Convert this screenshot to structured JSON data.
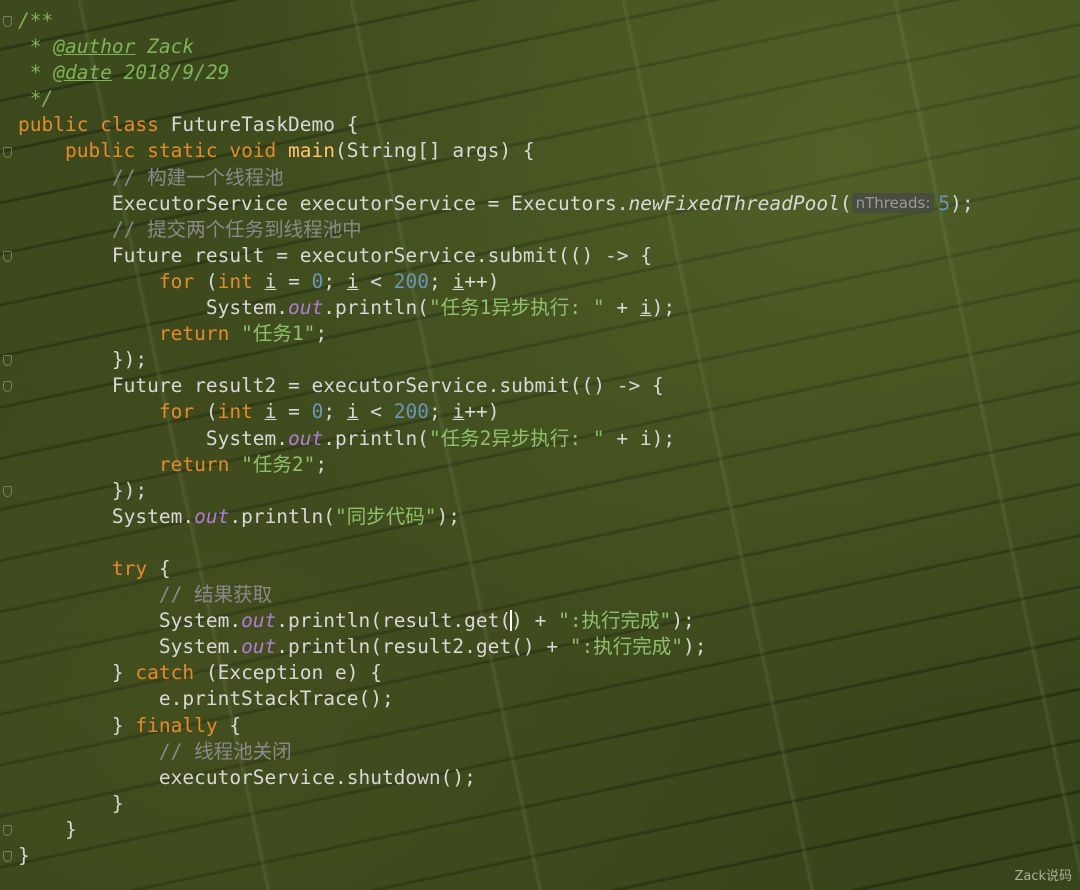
{
  "editor": {
    "language": "Java",
    "theme_colors": {
      "keyword": "#e38b2e",
      "method_decl": "#ffc66d",
      "number": "#6897bb",
      "string": "#8fc06c",
      "comment": "#8a8a8a",
      "static_field": "#b07bd8",
      "javadoc": "#7fb35a"
    },
    "lines": [
      [
        {
          "t": "/**",
          "c": "doc"
        }
      ],
      [
        {
          "t": " * ",
          "c": "doc"
        },
        {
          "t": "@author",
          "c": "doc-tag"
        },
        {
          "t": " Zack",
          "c": "doc"
        }
      ],
      [
        {
          "t": " * ",
          "c": "doc"
        },
        {
          "t": "@date",
          "c": "doc-tag"
        },
        {
          "t": " 2018/9/29",
          "c": "doc"
        }
      ],
      [
        {
          "t": " */",
          "c": "doc"
        }
      ],
      [
        {
          "t": "public class",
          "c": "kw"
        },
        {
          "t": " FutureTaskDemo {"
        }
      ],
      [
        {
          "t": "    "
        },
        {
          "t": "public static void",
          "c": "kw"
        },
        {
          "t": " "
        },
        {
          "t": "main",
          "c": "fn"
        },
        {
          "t": "(String[] args) {"
        }
      ],
      [
        {
          "t": "        "
        },
        {
          "t": "// 构建一个线程池",
          "c": "cmt"
        }
      ],
      [
        {
          "t": "        ExecutorService executorService = Executors."
        },
        {
          "t": "newFixedThreadPool",
          "c": "it"
        },
        {
          "t": "("
        },
        {
          "t": "nThreads:",
          "c": "hint"
        },
        {
          "t": "5",
          "c": "num"
        },
        {
          "t": ");"
        }
      ],
      [
        {
          "t": "        "
        },
        {
          "t": "// 提交两个任务到线程池中",
          "c": "cmt"
        }
      ],
      [
        {
          "t": "        Future result = executorService.submit(() -> {"
        }
      ],
      [
        {
          "t": "            "
        },
        {
          "t": "for",
          "c": "kw"
        },
        {
          "t": " ("
        },
        {
          "t": "int",
          "c": "kw"
        },
        {
          "t": " "
        },
        {
          "t": "i",
          "c": "ul"
        },
        {
          "t": " = "
        },
        {
          "t": "0",
          "c": "num"
        },
        {
          "t": "; "
        },
        {
          "t": "i",
          "c": "ul"
        },
        {
          "t": " < "
        },
        {
          "t": "200",
          "c": "num"
        },
        {
          "t": "; "
        },
        {
          "t": "i",
          "c": "ul"
        },
        {
          "t": "++)"
        }
      ],
      [
        {
          "t": "                System."
        },
        {
          "t": "out",
          "c": "st"
        },
        {
          "t": ".println("
        },
        {
          "t": "\"任务1异步执行: \"",
          "c": "str"
        },
        {
          "t": " + "
        },
        {
          "t": "i",
          "c": "ul"
        },
        {
          "t": ");"
        }
      ],
      [
        {
          "t": "            "
        },
        {
          "t": "return",
          "c": "kw"
        },
        {
          "t": " "
        },
        {
          "t": "\"任务1\"",
          "c": "str"
        },
        {
          "t": ";"
        }
      ],
      [
        {
          "t": "        });"
        }
      ],
      [
        {
          "t": "        Future result2 = executorService.submit(() -> {"
        }
      ],
      [
        {
          "t": "            "
        },
        {
          "t": "for",
          "c": "kw"
        },
        {
          "t": " ("
        },
        {
          "t": "int",
          "c": "kw"
        },
        {
          "t": " "
        },
        {
          "t": "i",
          "c": "ul"
        },
        {
          "t": " = "
        },
        {
          "t": "0",
          "c": "num"
        },
        {
          "t": "; "
        },
        {
          "t": "i",
          "c": "ul"
        },
        {
          "t": " < "
        },
        {
          "t": "200",
          "c": "num"
        },
        {
          "t": "; "
        },
        {
          "t": "i",
          "c": "ul"
        },
        {
          "t": "++)"
        }
      ],
      [
        {
          "t": "                System."
        },
        {
          "t": "out",
          "c": "st"
        },
        {
          "t": ".println("
        },
        {
          "t": "\"任务2异步执行: \"",
          "c": "str"
        },
        {
          "t": " + i);"
        }
      ],
      [
        {
          "t": "            "
        },
        {
          "t": "return",
          "c": "kw"
        },
        {
          "t": " "
        },
        {
          "t": "\"任务2\"",
          "c": "str"
        },
        {
          "t": ";"
        }
      ],
      [
        {
          "t": "        });"
        }
      ],
      [
        {
          "t": "        System."
        },
        {
          "t": "out",
          "c": "st"
        },
        {
          "t": ".println("
        },
        {
          "t": "\"同步代码\"",
          "c": "str"
        },
        {
          "t": ");"
        }
      ],
      [
        {
          "t": ""
        }
      ],
      [
        {
          "t": "        "
        },
        {
          "t": "try",
          "c": "kw"
        },
        {
          "t": " {"
        }
      ],
      [
        {
          "t": "            "
        },
        {
          "t": "// 结果获取",
          "c": "cmt"
        }
      ],
      [
        {
          "t": "            System."
        },
        {
          "t": "out",
          "c": "st"
        },
        {
          "t": ".println(result.get("
        },
        {
          "t": "",
          "c": "caret"
        },
        {
          "t": ") + "
        },
        {
          "t": "\":执行完成\"",
          "c": "str"
        },
        {
          "t": ");"
        }
      ],
      [
        {
          "t": "            System."
        },
        {
          "t": "out",
          "c": "st"
        },
        {
          "t": ".println(result2.get() + "
        },
        {
          "t": "\":执行完成\"",
          "c": "str"
        },
        {
          "t": ");"
        }
      ],
      [
        {
          "t": "        } "
        },
        {
          "t": "catch",
          "c": "kw"
        },
        {
          "t": " (Exception e) {"
        }
      ],
      [
        {
          "t": "            e.printStackTrace();"
        }
      ],
      [
        {
          "t": "        } "
        },
        {
          "t": "finally",
          "c": "kw"
        },
        {
          "t": " {"
        }
      ],
      [
        {
          "t": "            "
        },
        {
          "t": "// 线程池关闭",
          "c": "cmt"
        }
      ],
      [
        {
          "t": "            executorService.shutdown();"
        }
      ],
      [
        {
          "t": "        }"
        }
      ],
      [
        {
          "t": "    }"
        }
      ],
      [
        {
          "t": "}"
        }
      ]
    ],
    "fold_marker_lines": [
      0,
      5,
      9,
      13,
      14,
      18,
      31,
      32
    ]
  },
  "watermark": "Zack说码"
}
